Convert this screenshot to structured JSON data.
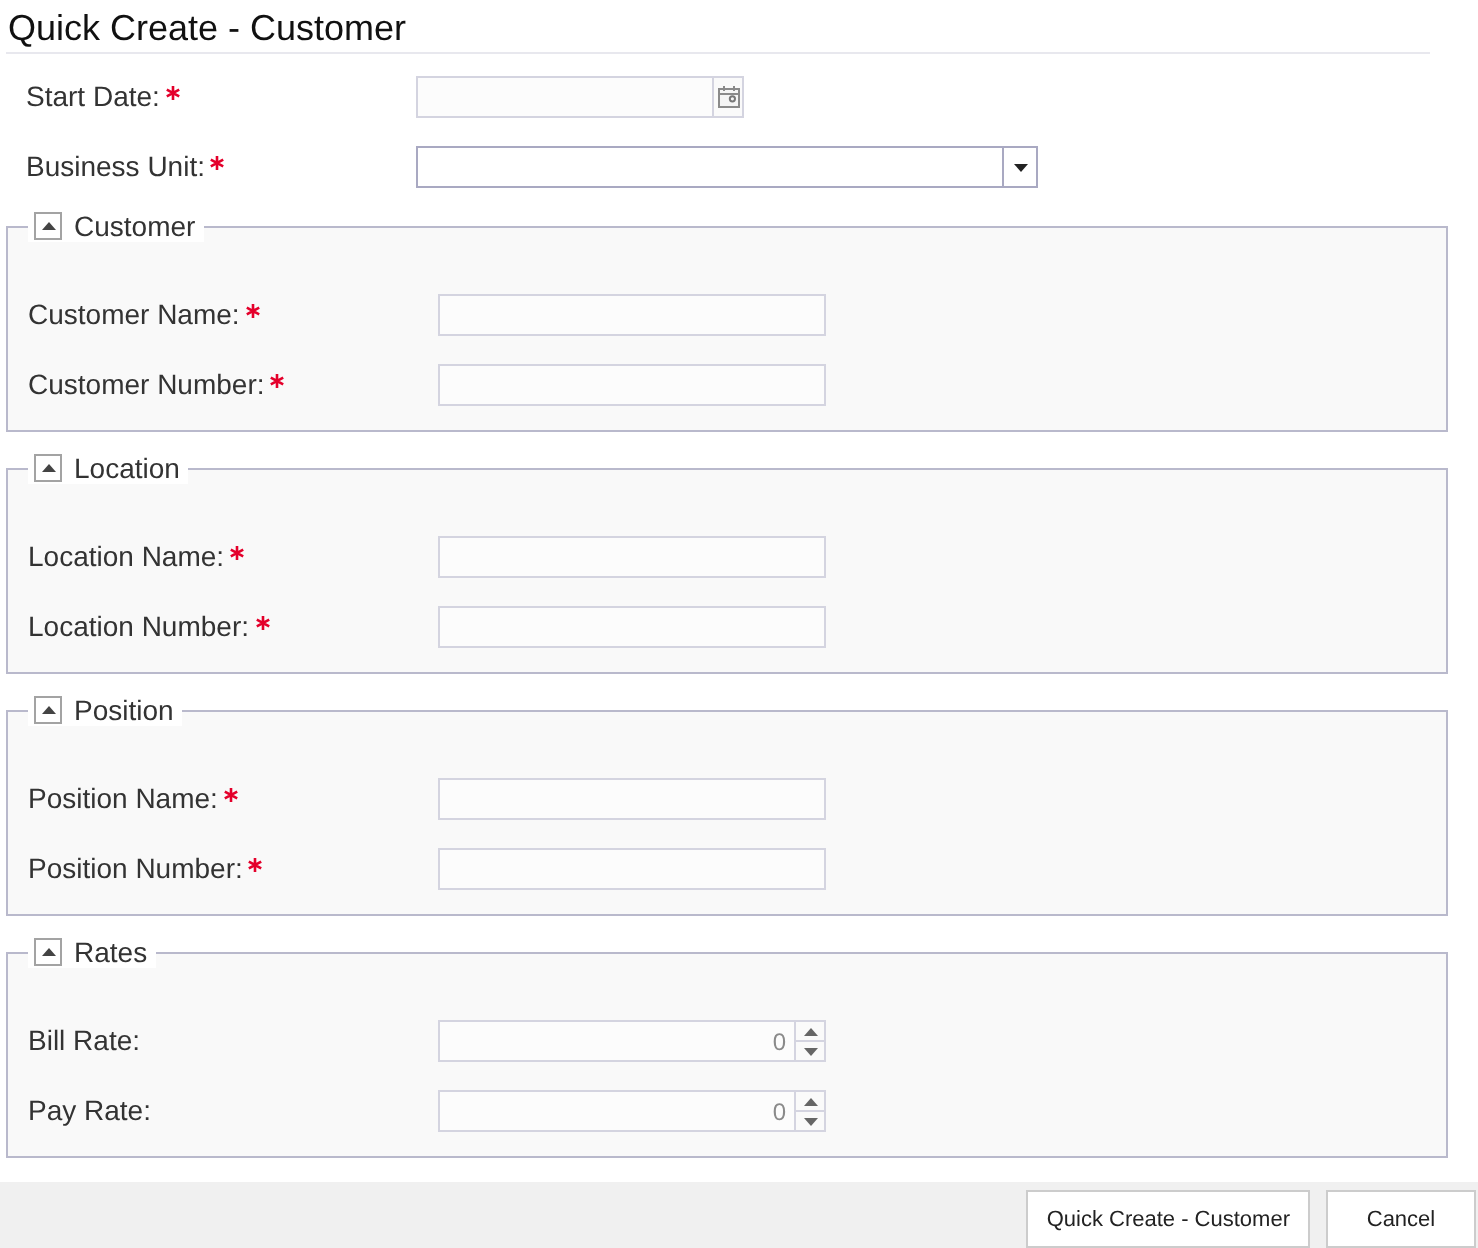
{
  "window": {
    "title": "Quick Create - Customer"
  },
  "fields": [
    {
      "kind": "date",
      "label": "Start Date:",
      "required": true
    },
    {
      "kind": "dropdown",
      "label": "Business Unit:",
      "required": true
    }
  ],
  "sections": [
    {
      "title": "Customer",
      "expanded": true,
      "fields": [
        {
          "kind": "text",
          "label": "Customer Name:",
          "required": true
        },
        {
          "kind": "text",
          "label": "Customer Number:",
          "required": true
        }
      ]
    },
    {
      "title": "Location",
      "expanded": true,
      "fields": [
        {
          "kind": "text",
          "label": "Location Name:",
          "required": true
        },
        {
          "kind": "text",
          "label": "Location Number:",
          "required": true
        }
      ]
    },
    {
      "title": "Position",
      "expanded": true,
      "fields": [
        {
          "kind": "text",
          "label": "Position Name:",
          "required": true
        },
        {
          "kind": "text",
          "label": "Position Number:",
          "required": true
        }
      ]
    },
    {
      "title": "Rates",
      "expanded": true,
      "fields": [
        {
          "kind": "number",
          "label": "Bill Rate:",
          "required": false,
          "value": "0"
        },
        {
          "kind": "number",
          "label": "Pay Rate:",
          "required": false,
          "value": "0"
        }
      ]
    }
  ],
  "buttons": [
    {
      "label": "Quick Create - Customer"
    },
    {
      "label": "Cancel"
    }
  ]
}
